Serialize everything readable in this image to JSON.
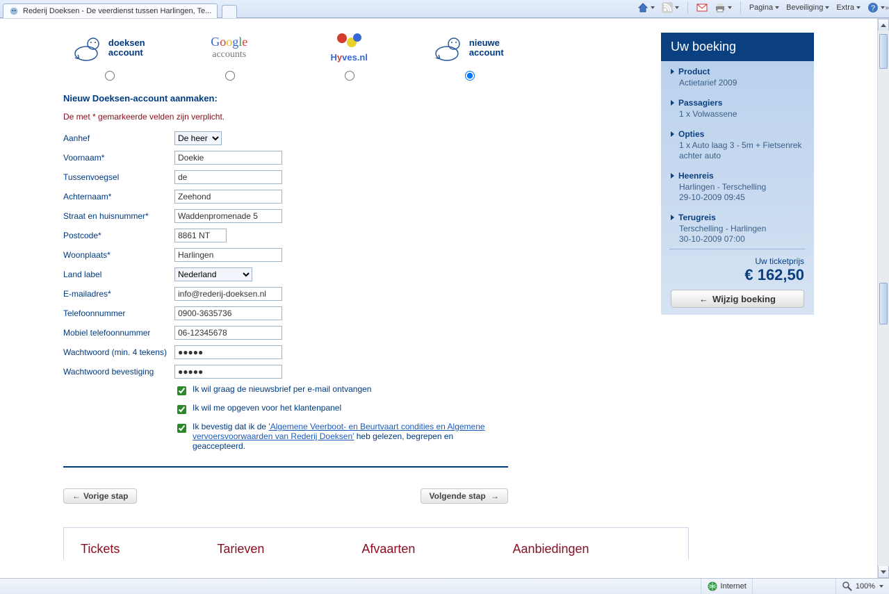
{
  "window": {
    "tab_title": "Rederij Doeksen - De veerdienst tussen Harlingen, Te...",
    "toolbar": {
      "page": "Pagina",
      "security": "Beveiliging",
      "extra": "Extra"
    }
  },
  "accounts": {
    "options": [
      {
        "name": "doeksen account",
        "logo": "seal"
      },
      {
        "name": "Google accounts",
        "logo": "google"
      },
      {
        "name": "Hyves.nl",
        "logo": "hyves"
      },
      {
        "name": "nieuwe account",
        "logo": "seal"
      }
    ],
    "selected_index": 3
  },
  "form": {
    "heading": "Nieuw Doeksen-account aanmaken:",
    "required_note": "De met * gemarkeerde velden zijn verplicht.",
    "labels": {
      "salutation": "Aanhef",
      "firstname": "Voornaam*",
      "infix": "Tussenvoegsel",
      "lastname": "Achternaam*",
      "street": "Straat en huisnummer*",
      "postcode": "Postcode*",
      "city": "Woonplaats*",
      "country": "Land label",
      "email": "E-mailadres*",
      "phone": "Telefoonnummer",
      "mobile": "Mobiel telefoonnummer",
      "password": "Wachtwoord (min. 4 tekens)",
      "password2": "Wachtwoord bevestiging"
    },
    "values": {
      "salutation": "De heer",
      "firstname": "Doekie",
      "infix": "de",
      "lastname": "Zeehond",
      "street": "Waddenpromenade 5",
      "postcode": "8861 NT",
      "city": "Harlingen",
      "country": "Nederland",
      "email": "info@rederij-doeksen.nl",
      "phone": "0900-3635736",
      "mobile": "06-12345678",
      "password": "●●●●●",
      "password2": "●●●●●"
    },
    "checkboxes": {
      "newsletter": "Ik wil graag de nieuwsbrief per e-mail ontvangen",
      "panel": "Ik wil me opgeven voor het klantenpanel",
      "terms_pre": "Ik bevestig dat ik de ",
      "terms_link": "'Algemene Veerboot- en Beurtvaart condities en Algemene vervoersvoorwaarden van Rederij Doeksen'",
      "terms_post": " heb gelezen, begrepen en geaccepteerd."
    },
    "buttons": {
      "prev": "Vorige stap",
      "next": "Volgende stap"
    }
  },
  "booking": {
    "title": "Uw boeking",
    "sections": {
      "product": {
        "label": "Product",
        "value": "Actietarief 2009"
      },
      "passengers": {
        "label": "Passagiers",
        "value": "1 x Volwassene"
      },
      "options": {
        "label": "Opties",
        "value": "1 x Auto laag 3 - 5m + Fietsenrek achter auto"
      },
      "outbound": {
        "label": "Heenreis",
        "value": "Harlingen - Terschelling\n29-10-2009 09:45"
      },
      "return": {
        "label": "Terugreis",
        "value": "Terschelling - Harlingen\n30-10-2009 07:00"
      }
    },
    "price_label": "Uw ticketprijs",
    "price": "€ 162,50",
    "edit_button": "Wijzig boeking"
  },
  "footer_tabs": {
    "tickets": "Tickets",
    "tarieven": "Tarieven",
    "afvaarten": "Afvaarten",
    "aanbiedingen": "Aanbiedingen"
  },
  "statusbar": {
    "zone": "Internet",
    "zoom": "100%"
  }
}
